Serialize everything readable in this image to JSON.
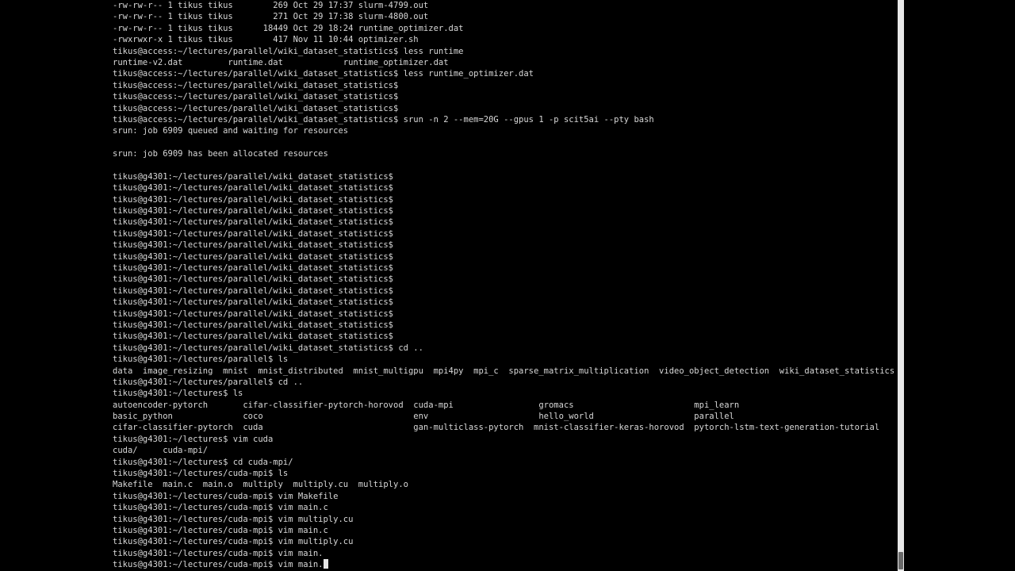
{
  "terminal": {
    "lines": [
      "-rw-rw-r-- 1 tikus tikus        269 Oct 29 17:37 slurm-4799.out",
      "-rw-rw-r-- 1 tikus tikus        271 Oct 29 17:38 slurm-4800.out",
      "-rw-rw-r-- 1 tikus tikus      18449 Oct 29 18:24 runtime_optimizer.dat",
      "-rwxrwxr-x 1 tikus tikus        417 Nov 11 10:44 optimizer.sh",
      "tikus@access:~/lectures/parallel/wiki_dataset_statistics$ less runtime",
      "runtime-v2.dat         runtime.dat            runtime_optimizer.dat",
      "tikus@access:~/lectures/parallel/wiki_dataset_statistics$ less runtime_optimizer.dat",
      "tikus@access:~/lectures/parallel/wiki_dataset_statistics$",
      "tikus@access:~/lectures/parallel/wiki_dataset_statistics$",
      "tikus@access:~/lectures/parallel/wiki_dataset_statistics$",
      "tikus@access:~/lectures/parallel/wiki_dataset_statistics$ srun -n 2 --mem=20G --gpus 1 -p scit5ai --pty bash",
      "srun: job 6909 queued and waiting for resources",
      "",
      "srun: job 6909 has been allocated resources",
      "",
      "tikus@g4301:~/lectures/parallel/wiki_dataset_statistics$",
      "tikus@g4301:~/lectures/parallel/wiki_dataset_statistics$",
      "tikus@g4301:~/lectures/parallel/wiki_dataset_statistics$",
      "tikus@g4301:~/lectures/parallel/wiki_dataset_statistics$",
      "tikus@g4301:~/lectures/parallel/wiki_dataset_statistics$",
      "tikus@g4301:~/lectures/parallel/wiki_dataset_statistics$",
      "tikus@g4301:~/lectures/parallel/wiki_dataset_statistics$",
      "tikus@g4301:~/lectures/parallel/wiki_dataset_statistics$",
      "tikus@g4301:~/lectures/parallel/wiki_dataset_statistics$",
      "tikus@g4301:~/lectures/parallel/wiki_dataset_statistics$",
      "tikus@g4301:~/lectures/parallel/wiki_dataset_statistics$",
      "tikus@g4301:~/lectures/parallel/wiki_dataset_statistics$",
      "tikus@g4301:~/lectures/parallel/wiki_dataset_statistics$",
      "tikus@g4301:~/lectures/parallel/wiki_dataset_statistics$",
      "tikus@g4301:~/lectures/parallel/wiki_dataset_statistics$",
      "tikus@g4301:~/lectures/parallel/wiki_dataset_statistics$ cd ..",
      "tikus@g4301:~/lectures/parallel$ ls",
      "data  image_resizing  mnist  mnist_distributed  mnist_multigpu  mpi4py  mpi_c  sparse_matrix_multiplication  video_object_detection  wiki_dataset_statistics",
      "tikus@g4301:~/lectures/parallel$ cd ..",
      "tikus@g4301:~/lectures$ ls",
      "autoencoder-pytorch       cifar-classifier-pytorch-horovod  cuda-mpi                 gromacs                        mpi_learn",
      "basic_python              coco                              env                      hello_world                    parallel",
      "cifar-classifier-pytorch  cuda                              gan-multiclass-pytorch  mnist-classifier-keras-horovod  pytorch-lstm-text-generation-tutorial",
      "tikus@g4301:~/lectures$ vim cuda",
      "cuda/     cuda-mpi/",
      "tikus@g4301:~/lectures$ cd cuda-mpi/",
      "tikus@g4301:~/lectures/cuda-mpi$ ls",
      "Makefile  main.c  main.o  multiply  multiply.cu  multiply.o",
      "tikus@g4301:~/lectures/cuda-mpi$ vim Makefile",
      "tikus@g4301:~/lectures/cuda-mpi$ vim main.c",
      "tikus@g4301:~/lectures/cuda-mpi$ vim multiply.cu",
      "tikus@g4301:~/lectures/cuda-mpi$ vim main.c",
      "tikus@g4301:~/lectures/cuda-mpi$ vim multiply.cu",
      "tikus@g4301:~/lectures/cuda-mpi$ vim main."
    ],
    "current_input": "tikus@g4301:~/lectures/cuda-mpi$ vim main."
  },
  "colors": {
    "background": "#000000",
    "text": "#d8d8d8",
    "cursor": "#e6e6e6"
  }
}
